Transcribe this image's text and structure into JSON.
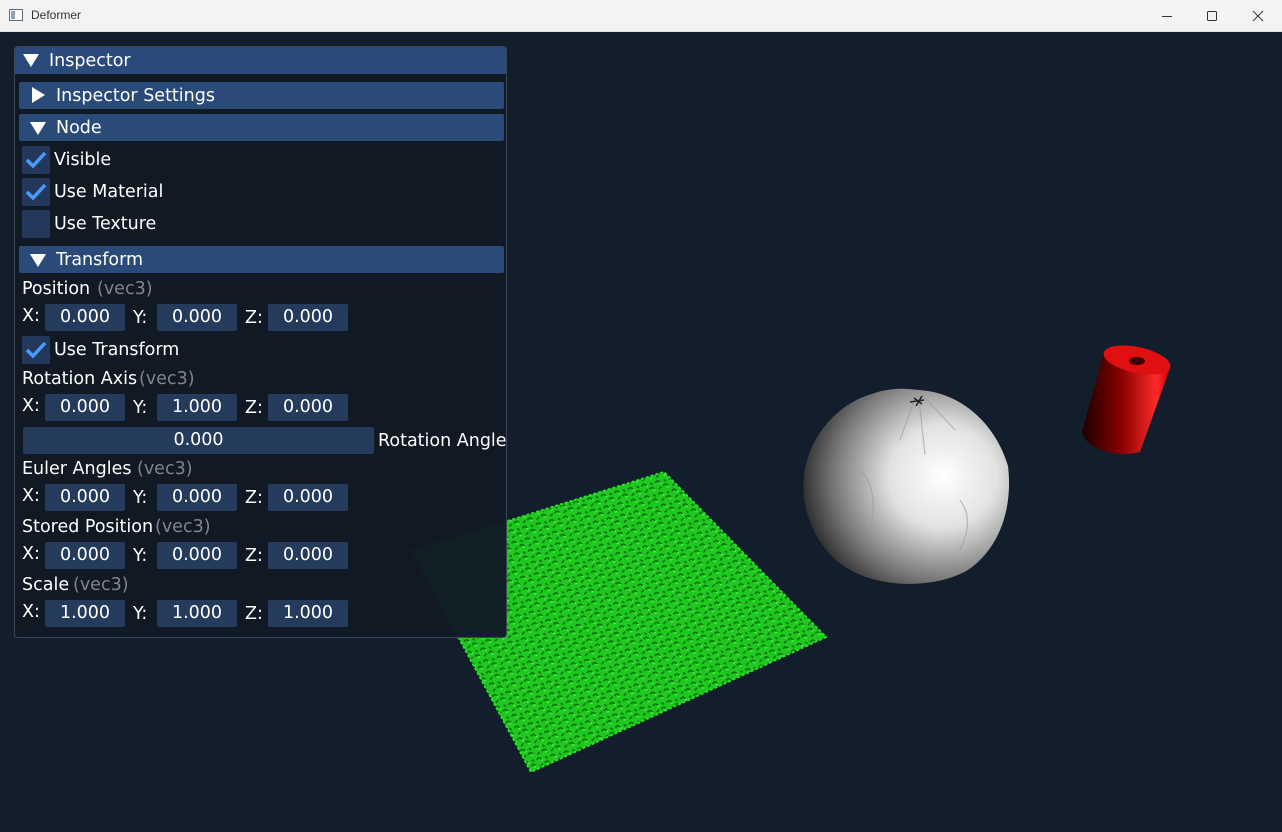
{
  "window": {
    "title": "Deformer",
    "minimize_icon": "minimize-icon",
    "maximize_icon": "maximize-icon",
    "close_icon": "close-icon"
  },
  "scene": {
    "objects": [
      "green-noise-plane",
      "white-deformed-sphere",
      "red-cylinder"
    ],
    "colors": {
      "background": "#121e2c",
      "plane": "#1fd21f",
      "sphere": "#ffffff",
      "cylinder": "#e01414"
    }
  },
  "inspector": {
    "title": "Inspector",
    "settings_header": "Inspector Settings",
    "node_header": "Node",
    "visible_label": "Visible",
    "visible_checked": true,
    "use_material_label": "Use Material",
    "use_material_checked": true,
    "use_texture_label": "Use Texture",
    "use_texture_checked": false,
    "transform_header": "Transform",
    "x_label": "X:",
    "y_label": "Y:",
    "z_label": "Z:",
    "type_hint": "(vec3)",
    "position": {
      "label": "Position",
      "x": "0.000",
      "y": "0.000",
      "z": "0.000"
    },
    "use_transform_label": "Use Transform",
    "use_transform_checked": true,
    "rotation_axis": {
      "label": "Rotation Axis",
      "x": "0.000",
      "y": "1.000",
      "z": "0.000"
    },
    "rotation_angle": {
      "label": "Rotation Angle",
      "value": "0.000"
    },
    "euler_angles": {
      "label": "Euler Angles",
      "x": "0.000",
      "y": "0.000",
      "z": "0.000"
    },
    "stored_position": {
      "label": "Stored Position",
      "x": "0.000",
      "y": "0.000",
      "z": "0.000"
    },
    "scale": {
      "label": "Scale",
      "x": "1.000",
      "y": "1.000",
      "z": "1.000"
    }
  }
}
